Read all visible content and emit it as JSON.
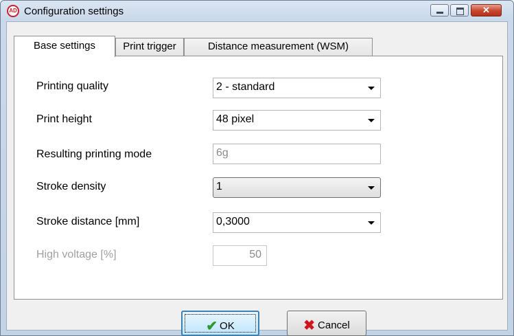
{
  "window": {
    "title": "Configuration settings",
    "app_icon_text": "AD",
    "close_glyph": "✕"
  },
  "tabs": [
    {
      "label": "Base settings",
      "active": true
    },
    {
      "label": "Print trigger",
      "active": false
    },
    {
      "label": "Distance measurement (WSM)",
      "active": false
    }
  ],
  "fields": {
    "printing_quality": {
      "label": "Printing quality",
      "value": "2 - standard"
    },
    "print_height": {
      "label": "Print height",
      "value": "48 pixel"
    },
    "resulting_mode": {
      "label": "Resulting printing mode",
      "value": "6g"
    },
    "stroke_density": {
      "label": "Stroke density",
      "value": "1"
    },
    "stroke_distance": {
      "label": "Stroke distance [mm]",
      "value": "0,3000"
    },
    "high_voltage": {
      "label": "High voltage [%]",
      "value": "50",
      "enabled": false
    }
  },
  "buttons": {
    "ok_label": "OK",
    "cancel_label": "Cancel",
    "ok_icon": "check-icon",
    "cancel_icon": "x-icon"
  },
  "colors": {
    "ok_check": "#2e9a2e",
    "cancel_x": "#d0141c",
    "close_button": "#c7452d"
  }
}
